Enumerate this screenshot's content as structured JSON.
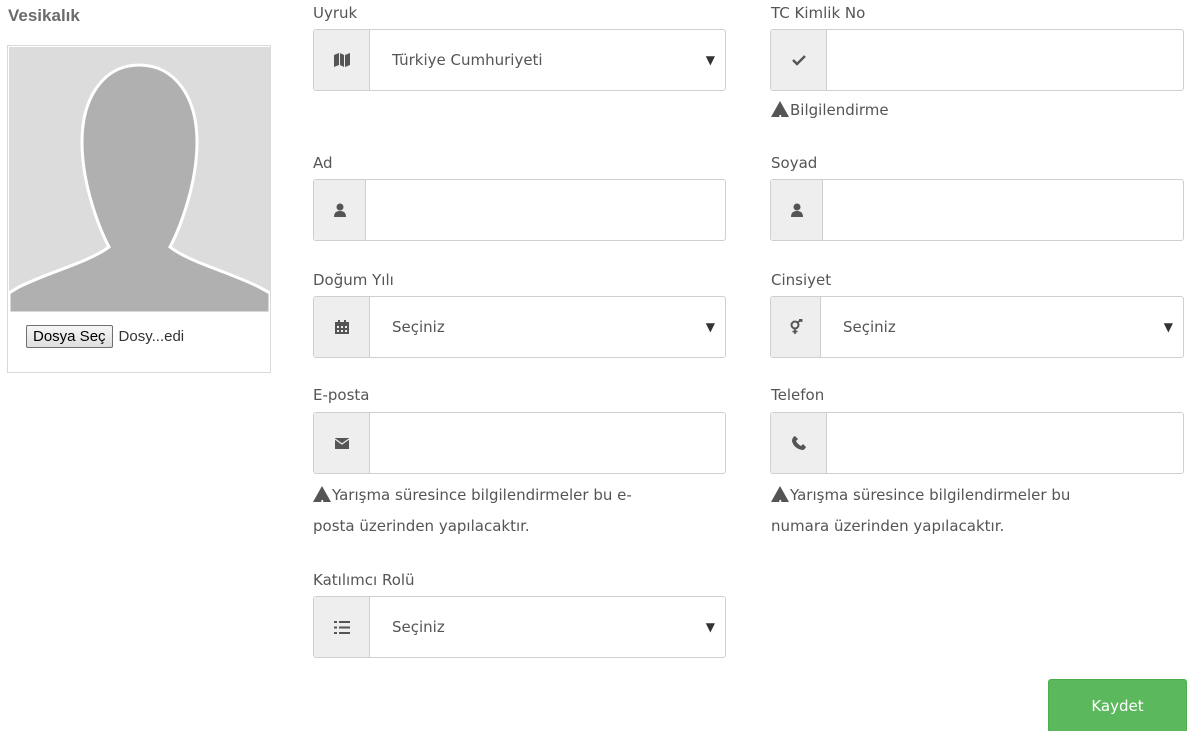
{
  "photo": {
    "title": "Vesikalık",
    "file_button": "Dosya Seç",
    "file_label": "Dosy...edi"
  },
  "fields": {
    "nationality": {
      "label": "Uyruk",
      "value": "Türkiye Cumhuriyeti",
      "icon": "map-icon"
    },
    "tc": {
      "label": "TC Kimlik No",
      "value": "",
      "icon": "check-icon",
      "hint": "Bilgilendirme"
    },
    "first_name": {
      "label": "Ad",
      "value": "",
      "icon": "user-icon"
    },
    "last_name": {
      "label": "Soyad",
      "value": "",
      "icon": "user-icon"
    },
    "birth_year": {
      "label": "Doğum Yılı",
      "value": "Seçiniz",
      "icon": "calendar-icon"
    },
    "gender": {
      "label": "Cinsiyet",
      "value": "Seçiniz",
      "icon": "gender-icon"
    },
    "email": {
      "label": "E-posta",
      "value": "",
      "icon": "envelope-icon",
      "hint_line1": "Yarışma süresince bilgilendirmeler bu e-",
      "hint_line2": "posta üzerinden yapılacaktır."
    },
    "phone": {
      "label": "Telefon",
      "value": "",
      "icon": "phone-icon",
      "hint_line1": "Yarışma süresince bilgilendirmeler bu",
      "hint_line2": "numara üzerinden yapılacaktır."
    },
    "role": {
      "label": "Katılımcı Rolü",
      "value": "Seçiniz",
      "icon": "list-icon"
    }
  },
  "caret": "▼",
  "actions": {
    "save_label": "Kaydet"
  },
  "colors": {
    "save": "#5cb85c",
    "addon": "#eeeeee",
    "border": "#cfcfcf"
  }
}
